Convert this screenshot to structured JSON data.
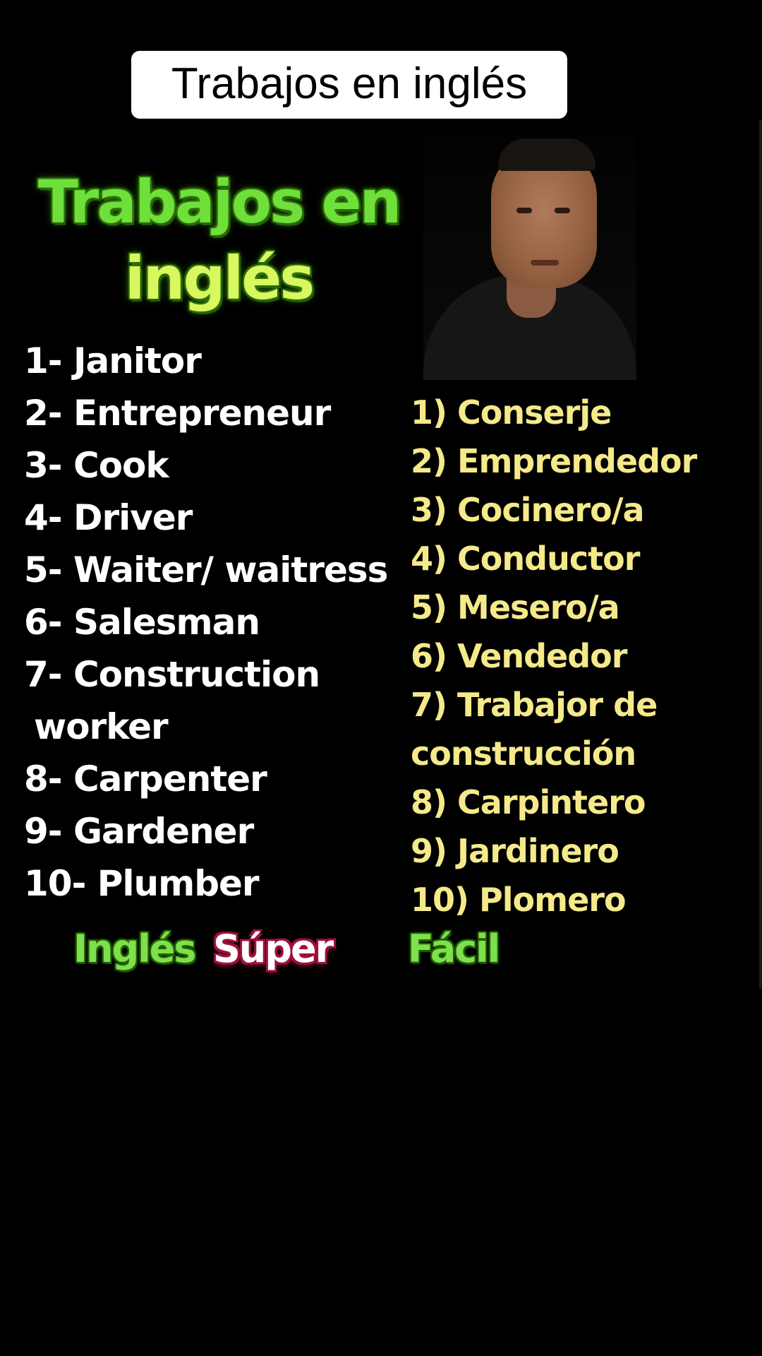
{
  "caption": {
    "text": "Trabajos en inglés"
  },
  "title": {
    "line1": "Trabajos en",
    "line2": "inglés"
  },
  "english_list": [
    "1- Janitor",
    "2- Entrepreneur",
    "3- Cook",
    "4- Driver",
    "5- Waiter/ waitress",
    "6- Salesman",
    "7- Construction",
    "worker",
    "8- Carpenter",
    "9- Gardener",
    "10- Plumber"
  ],
  "spanish_list": [
    "1) Conserje",
    "2) Emprendedor",
    "3) Cocinero/a",
    "4) Conductor",
    "5) Mesero/a",
    "6) Vendedor",
    "7) Trabajor de",
    "construcción",
    "8) Carpintero",
    "9) Jardinero",
    "10) Plomero"
  ],
  "brand": {
    "word1": "Inglés",
    "word2": "Súper",
    "word3": "Fácil"
  },
  "colors": {
    "background": "#000000",
    "caption_bg": "#ffffff",
    "title_green": "#6fe03a",
    "english_text": "#ffffff",
    "spanish_text": "#f5e98a",
    "brand_accent": "#a0103a"
  }
}
